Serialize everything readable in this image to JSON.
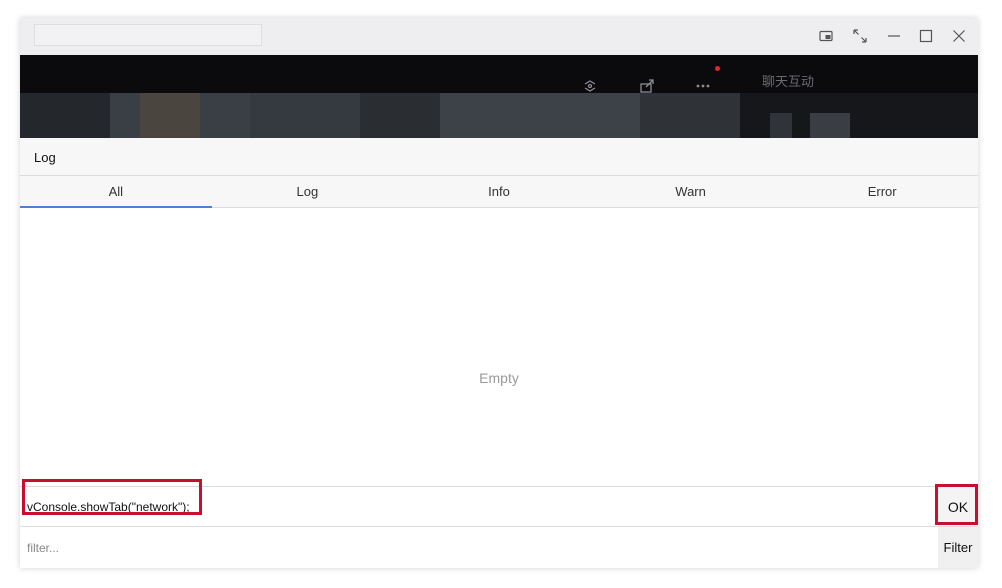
{
  "titlebar": {
    "controls": [
      {
        "name": "pip-icon",
        "label": "picture-in-picture"
      },
      {
        "name": "expand-icon",
        "label": "expand"
      },
      {
        "name": "minimize-icon",
        "label": "minimize"
      },
      {
        "name": "maximize-icon",
        "label": "maximize"
      },
      {
        "name": "close-icon",
        "label": "close"
      }
    ]
  },
  "media": {
    "icons": [
      "screen-share-icon",
      "share-icon",
      "more-icon"
    ],
    "chat_label": "聊天互动",
    "notify_color": "#e0282e"
  },
  "vconsole": {
    "header_label": "Log",
    "tabs": [
      {
        "label": "All",
        "active": true
      },
      {
        "label": "Log",
        "active": false
      },
      {
        "label": "Info",
        "active": false
      },
      {
        "label": "Warn",
        "active": false
      },
      {
        "label": "Error",
        "active": false
      }
    ],
    "empty_text": "Empty",
    "command_value": "vConsole.showTab(\"network\");",
    "ok_label": "OK",
    "filter_placeholder": "filter...",
    "filter_label": "Filter"
  },
  "colors": {
    "active_tab": "#4c82d6",
    "highlight": "#c8102e"
  }
}
